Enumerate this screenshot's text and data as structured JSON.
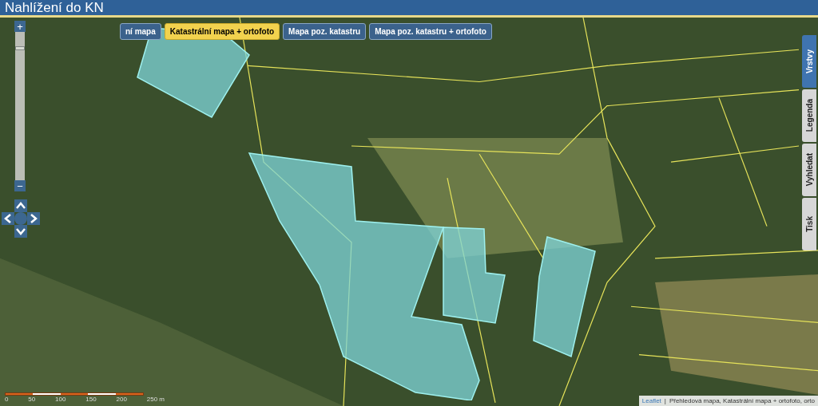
{
  "window": {
    "title": "Nahlížení do KN"
  },
  "zoom": {
    "in": "+",
    "out": "−",
    "level": 0.9
  },
  "base_layers": [
    {
      "label": "ní mapa",
      "selected": false
    },
    {
      "label": "Katastrální mapa + ortofoto",
      "selected": true
    },
    {
      "label": "Mapa poz. katastru",
      "selected": false
    },
    {
      "label": "Mapa poz. katastru + ortofoto",
      "selected": false
    }
  ],
  "side_tabs": [
    {
      "label": "Vrstvy",
      "selected": true
    },
    {
      "label": "Legenda",
      "selected": false
    },
    {
      "label": "Vyhledat",
      "selected": false
    },
    {
      "label": "Tisk",
      "selected": false
    }
  ],
  "scale": {
    "ticks": [
      "0",
      "50",
      "100",
      "150",
      "200",
      "250 m"
    ]
  },
  "attribution": {
    "link": "Leaflet",
    "separator": "|",
    "text": "Přehledová mapa, Katastrální mapa + ortofoto, orto"
  }
}
